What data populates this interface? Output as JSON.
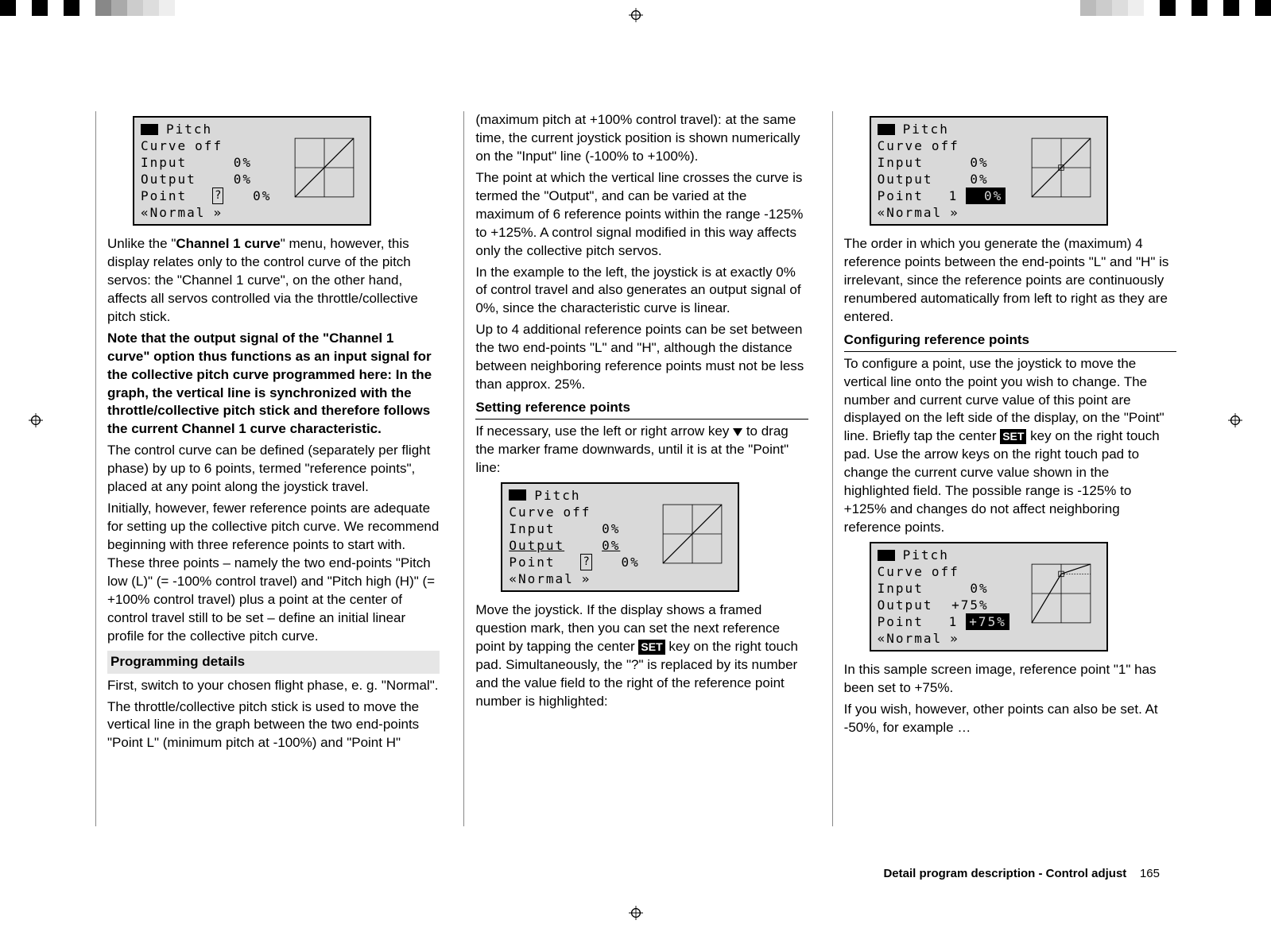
{
  "colorbar_left": [
    "#000",
    "#fff",
    "#000",
    "#fff",
    "#000",
    "#fff",
    "#888",
    "#aaa",
    "#ccc",
    "#ddd",
    "#eee",
    "#fff"
  ],
  "colorbar_right": [
    "#bbb",
    "#ccc",
    "#ddd",
    "#eee",
    "#fff",
    "#000",
    "#fff",
    "#000",
    "#fff",
    "#000",
    "#fff",
    "#000"
  ],
  "screens": {
    "s1": {
      "title": "Pitch",
      "curve": "Curve",
      "curve_state": "off",
      "input_label": "Input",
      "input_val": "0%",
      "output_label": "Output",
      "output_val": "0%",
      "point_label": "Point",
      "point_marker": "?",
      "point_val": "0%",
      "phase": "«Normal",
      "phase_arrow": "»"
    },
    "s2": {
      "title": "Pitch",
      "curve": "Curve",
      "curve_state": "off",
      "input_label": "Input",
      "input_val": "0%",
      "output_label": "Output",
      "output_val": "0%",
      "point_label": "Point",
      "point_marker": "?",
      "point_val": "0%",
      "phase": "«Normal",
      "phase_arrow": "»"
    },
    "s3": {
      "title": "Pitch",
      "curve": "Curve",
      "curve_state": "off",
      "input_label": "Input",
      "input_val": "0%",
      "output_label": "Output",
      "output_val": "0%",
      "point_label": "Point",
      "point_marker": "1",
      "point_val": "0%",
      "phase": "«Normal",
      "phase_arrow": "»"
    },
    "s4": {
      "title": "Pitch",
      "curve": "Curve",
      "curve_state": "off",
      "input_label": "Input",
      "input_val": "0%",
      "output_label": "Output",
      "output_val": "+75%",
      "point_label": "Point",
      "point_marker": "1",
      "point_val": "+75%",
      "phase": "«Normal",
      "phase_arrow": "»"
    }
  },
  "col1": {
    "p1a": "Unlike the \"",
    "p1b": "Channel 1 curve",
    "p1c": "\" menu, however, this display relates only to the control curve of the pitch servos: the \"Channel 1 curve\", on the other hand, affects all servos controlled via the throttle/collective pitch stick.",
    "p2": "Note that the output signal of the \"Channel 1 curve\" option thus functions as an input signal for the collective pitch curve programmed here: In the graph, the vertical line is synchronized with the throttle/collective pitch stick and therefore follows the current Channel 1 curve characteristic.",
    "p3": "The control curve can be defined (separately per flight phase) by up to 6 points, termed \"reference points\", placed at any point along the joystick travel.",
    "p4": "Initially, however, fewer reference points are adequate for setting up the collective pitch curve. We recommend beginning with three reference points to start with. These three points – namely the two end-points \"Pitch low (L)\" (= -100% control travel) and \"Pitch high (H)\" (= +100% control travel) plus a point at the center of control travel still to be set – define an initial linear profile for the collective pitch curve.",
    "sub1": "Programming details",
    "p5": "First, switch to your chosen flight phase, e. g. \"Normal\".",
    "p6": "The throttle/collective pitch stick is used to move the vertical line in the graph between the two end-points \"Point L\" (minimum pitch at -100%) and \"Point H\""
  },
  "col2": {
    "p1": "(maximum pitch at +100% control travel): at the same time, the current joystick position is shown numerically on the \"Input\" line (-100% to +100%).",
    "p2": "The point at which the vertical line crosses the curve is termed the \"Output\", and can be varied at the maximum of 6 reference points within the range -125% to +125%. A control signal modified in this way affects only the collective pitch servos.",
    "p3": "In the example to the left, the joystick is at exactly 0% of control travel and also generates an output signal of 0%, since the characteristic curve is linear.",
    "p4": "Up to 4 additional reference points can be set between the two end-points \"L\" and \"H\", although the distance between neighboring reference points must not be less than approx. 25%.",
    "sub1": "Setting reference points",
    "p5a": "If necessary, use the left or right arrow key ",
    "p5b": " to drag the marker frame downwards, until it is at the \"Point\" line:",
    "p6a": "Move the joystick. If the display shows a framed question mark, then you can set the next reference point by tapping the center ",
    "p6b": " key on the right touch pad. Simultaneously, the \"?\" is replaced by its number and the value field to the right of the reference point number is highlighted:",
    "set": "SET"
  },
  "col3": {
    "p1": "The order in which you generate the (maximum) 4 reference points between the end-points \"L\" and \"H\" is irrelevant, since the reference points are continuously renumbered automatically from left to right as they are entered.",
    "sub1": "Configuring reference points",
    "p2a": "To configure a point, use the joystick to move the vertical line onto the point you wish to change. The number and current curve value of this point are displayed on the left side of the display, on the \"Point\" line. Briefly tap the center ",
    "p2b": " key on the right touch pad. Use the arrow keys on the right touch pad to change the current curve value shown in the highlighted field. The possible range is -125% to +125% and changes do not affect neighboring reference points.",
    "set": "SET",
    "p3": "In this sample screen image, reference point \"1\" has been set to +75%.",
    "p4": "If you wish, however, other points can also be set. At -50%, for example …"
  },
  "footer": {
    "title": "Detail program description - Control adjust",
    "page": "165"
  }
}
